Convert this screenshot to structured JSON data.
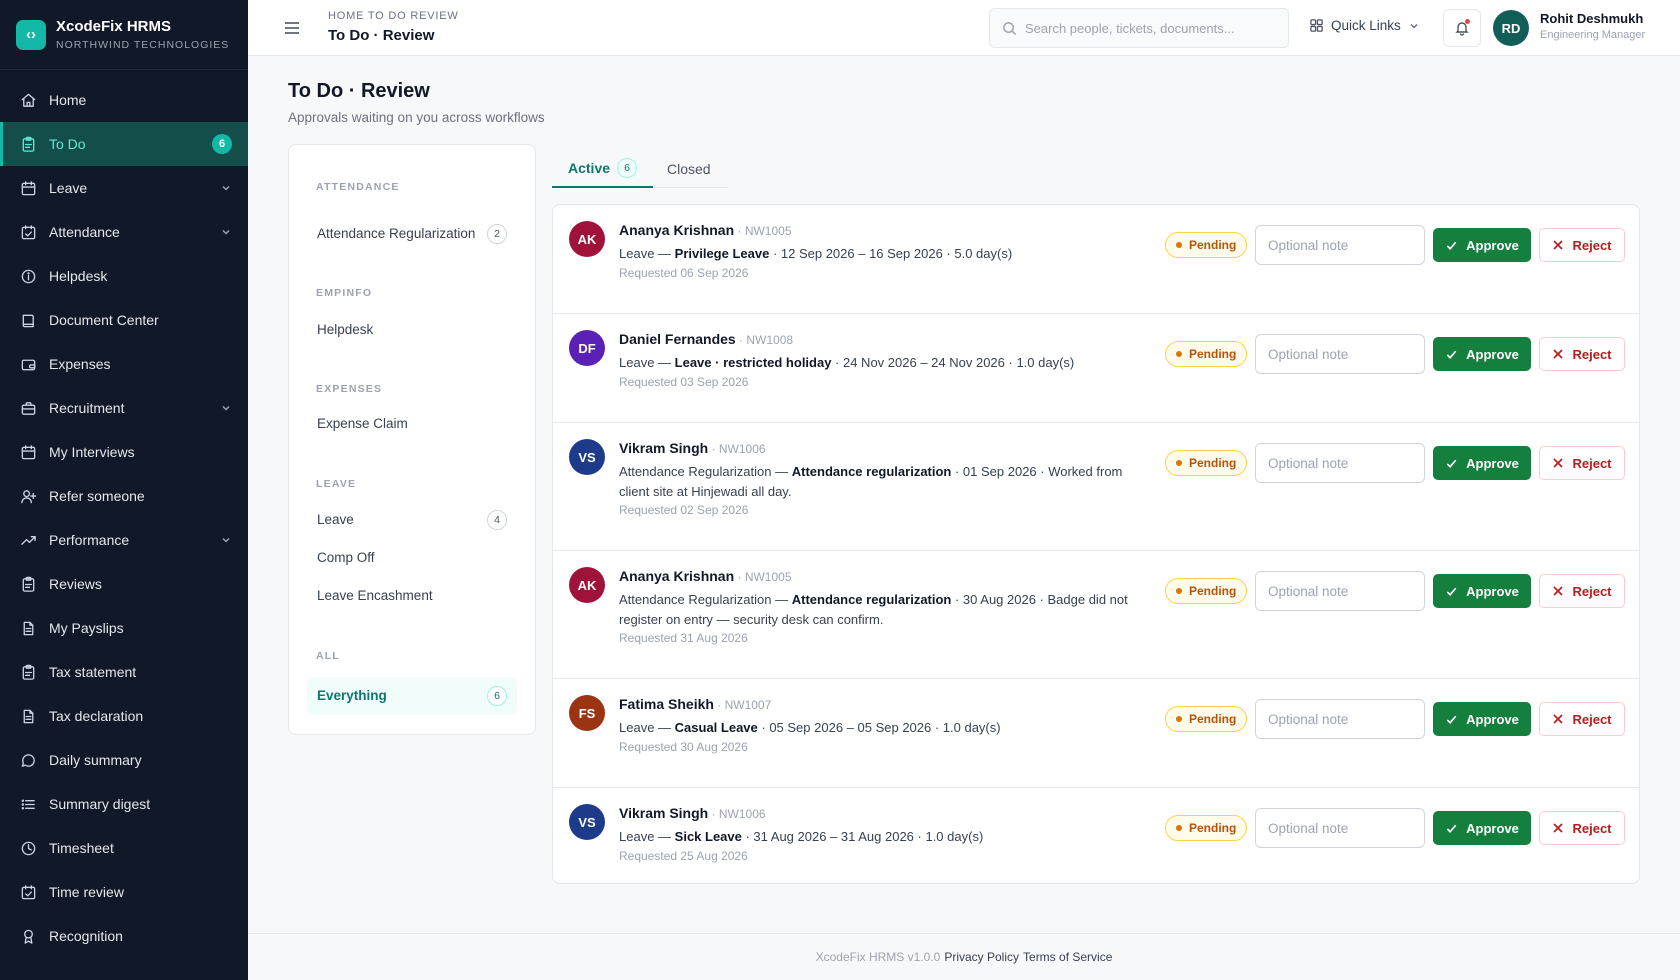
{
  "brand": {
    "name": "XcodeFix HRMS",
    "org": "NORTHWIND TECHNOLOGIES"
  },
  "sidebar": {
    "items": [
      {
        "label": "Home",
        "icon": "home-icon"
      },
      {
        "label": "To Do",
        "icon": "clipboard-icon",
        "badge": "6",
        "active": true
      },
      {
        "label": "Leave",
        "icon": "calendar-icon",
        "expandable": true
      },
      {
        "label": "Attendance",
        "icon": "calendar-check-icon",
        "expandable": true
      },
      {
        "label": "Helpdesk",
        "icon": "info-icon"
      },
      {
        "label": "Document Center",
        "icon": "book-icon"
      },
      {
        "label": "Expenses",
        "icon": "wallet-icon"
      },
      {
        "label": "Recruitment",
        "icon": "briefcase-icon",
        "expandable": true
      },
      {
        "label": "My Interviews",
        "icon": "calendar-icon"
      },
      {
        "label": "Refer someone",
        "icon": "user-plus-icon"
      },
      {
        "label": "Performance",
        "icon": "trending-up-icon",
        "expandable": true
      },
      {
        "label": "Reviews",
        "icon": "clipboard-icon"
      },
      {
        "label": "My Payslips",
        "icon": "file-icon"
      },
      {
        "label": "Tax statement",
        "icon": "clipboard-icon"
      },
      {
        "label": "Tax declaration",
        "icon": "file-icon"
      },
      {
        "label": "Daily summary",
        "icon": "message-icon"
      },
      {
        "label": "Summary digest",
        "icon": "list-icon"
      },
      {
        "label": "Timesheet",
        "icon": "clock-icon"
      },
      {
        "label": "Time review",
        "icon": "calendar-check-icon"
      },
      {
        "label": "Recognition",
        "icon": "award-icon"
      }
    ]
  },
  "header": {
    "breadcrumb": "HOME TO DO REVIEW",
    "title": "To Do · Review",
    "search_placeholder": "Search people, tickets, documents...",
    "quick_links": "Quick Links",
    "user": {
      "initials": "RD",
      "name": "Rohit Deshmukh",
      "role": "Engineering Manager"
    }
  },
  "page": {
    "title": "To Do · Review",
    "subtitle": "Approvals waiting on you across workflows"
  },
  "categories": {
    "groups": [
      {
        "label": "ATTENDANCE",
        "items": [
          {
            "label": "Attendance Regularization",
            "count": "2"
          }
        ]
      },
      {
        "label": "EMPINFO",
        "items": [
          {
            "label": "Helpdesk"
          }
        ]
      },
      {
        "label": "EXPENSES",
        "items": [
          {
            "label": "Expense Claim"
          }
        ]
      },
      {
        "label": "LEAVE",
        "items": [
          {
            "label": "Leave",
            "count": "4"
          },
          {
            "label": "Comp Off"
          },
          {
            "label": "Leave Encashment"
          }
        ]
      },
      {
        "label": "ALL",
        "items": [
          {
            "label": "Everything",
            "count": "6",
            "active": true
          }
        ]
      }
    ]
  },
  "tabs": [
    {
      "label": "Active",
      "count": "6",
      "active": true
    },
    {
      "label": "Closed"
    }
  ],
  "rows": [
    {
      "initials": "AK",
      "color": "#9f1239",
      "name": "Ananya Krishnan",
      "id": "NW1005",
      "type": "Leave",
      "bold": "Privilege Leave",
      "detail": " · 12 Sep 2026 – 16 Sep 2026 · 5.0 day(s)",
      "requested": "Requested 06 Sep 2026",
      "status": "Pending"
    },
    {
      "initials": "DF",
      "color": "#5b21b6",
      "name": "Daniel Fernandes",
      "id": "NW1008",
      "type": "Leave",
      "bold": "Leave · restricted holiday",
      "detail": " · 24 Nov 2026 – 24 Nov 2026 · 1.0 day(s)",
      "requested": "Requested 03 Sep 2026",
      "status": "Pending"
    },
    {
      "initials": "VS",
      "color": "#1e3a8a",
      "name": "Vikram Singh",
      "id": "NW1006",
      "type": "Attendance Regularization",
      "bold": "Attendance regularization",
      "detail": " · 01 Sep 2026 · Worked from client site at Hinjewadi all day.",
      "requested": "Requested 02 Sep 2026",
      "status": "Pending"
    },
    {
      "initials": "AK",
      "color": "#9f1239",
      "name": "Ananya Krishnan",
      "id": "NW1005",
      "type": "Attendance Regularization",
      "bold": "Attendance regularization",
      "detail": " · 30 Aug 2026 · Badge did not register on entry — security desk can confirm.",
      "requested": "Requested 31 Aug 2026",
      "status": "Pending"
    },
    {
      "initials": "FS",
      "color": "#9a3412",
      "name": "Fatima Sheikh",
      "id": "NW1007",
      "type": "Leave",
      "bold": "Casual Leave",
      "detail": " · 05 Sep 2026 – 05 Sep 2026 · 1.0 day(s)",
      "requested": "Requested 30 Aug 2026",
      "status": "Pending"
    },
    {
      "initials": "VS",
      "color": "#1e3a8a",
      "name": "Vikram Singh",
      "id": "NW1006",
      "type": "Leave",
      "bold": "Sick Leave",
      "detail": " · 31 Aug 2026 – 31 Aug 2026 · 1.0 day(s)",
      "requested": "Requested 25 Aug 2026",
      "status": "Pending"
    }
  ],
  "actions": {
    "note_placeholder": "Optional note",
    "approve": "Approve",
    "reject": "Reject"
  },
  "footer": {
    "version": "XcodeFix HRMS v1.0.0",
    "privacy": "Privacy Policy",
    "terms": "Terms of Service"
  }
}
